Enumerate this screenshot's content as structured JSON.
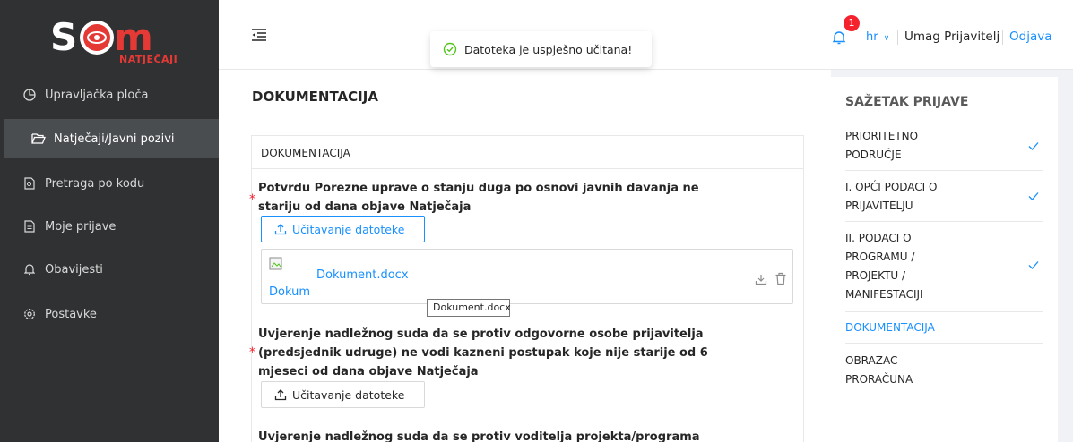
{
  "brand": {
    "logo_text": "NATJEČAJI",
    "logo_letters": "S m"
  },
  "sidebar": {
    "items": [
      {
        "label": "Upravljačka ploča",
        "icon": "pie-chart-icon"
      },
      {
        "label": "Natječaji/Javni pozivi",
        "icon": "folder-open-icon",
        "active": true
      },
      {
        "label": "Pretraga po kodu",
        "icon": "file-search-icon"
      },
      {
        "label": "Moje prijave",
        "icon": "file-text-icon"
      },
      {
        "label": "Obavijesti",
        "icon": "bell-icon"
      },
      {
        "label": "Postavke",
        "icon": "gear-icon"
      }
    ]
  },
  "header": {
    "notification_count": "1",
    "language": "hr",
    "user_name": "Umag Prijavitelj",
    "logout_label": "Odjava"
  },
  "toast": {
    "message": "Datoteka je uspješno učitana!"
  },
  "main": {
    "page_title": "DOKUMENTACIJA",
    "card_title": "DOKUMENTACIJA",
    "doc1": {
      "label_line1": "Potvrdu Porezne uprave o stanju duga po osnovi javnih davanja ne",
      "label_line2": "stariju od dana objave Natječaja",
      "upload_label": "Učitavanje datoteke",
      "file_name": "Dokument.docx",
      "file_alt": "Dokum",
      "tooltip": "Dokument.docx"
    },
    "doc2": {
      "label_line1": "Uvjerenje nadležnog suda da se protiv odgovorne osobe prijavitelja",
      "label_line2": "(predsjednik udruge) ne vodi kazneni postupak koje nije starije od 6",
      "label_line3": "mjeseci od dana objave Natječaja",
      "upload_label": "Učitavanje datoteke"
    },
    "doc3": {
      "label_line1": "Uvjerenje nadležnog suda da se protiv voditelja projekta/programa"
    }
  },
  "summary": {
    "title": "SAŽETAK PRIJAVE",
    "items": [
      {
        "line1": "PRIORITETNO",
        "line2": "PODRUČJE",
        "done": true
      },
      {
        "line1": "I. OPĆI PODACI O",
        "line2": "PRIJAVITELJU",
        "done": true
      },
      {
        "line1": "II. PODACI O",
        "line2": "PROGRAMU /",
        "line3": "PROJEKTU /",
        "line4": "MANIFESTACIJI",
        "done": true
      },
      {
        "line1": "DOKUMENTACIJA",
        "active": true
      },
      {
        "line1": "OBRAZAC",
        "line2": "PRORAČUNA"
      }
    ]
  },
  "colors": {
    "accent": "#1890ff",
    "sidebar_bg": "#2f3133",
    "danger": "#f5222d",
    "brand_red": "#e53935"
  }
}
